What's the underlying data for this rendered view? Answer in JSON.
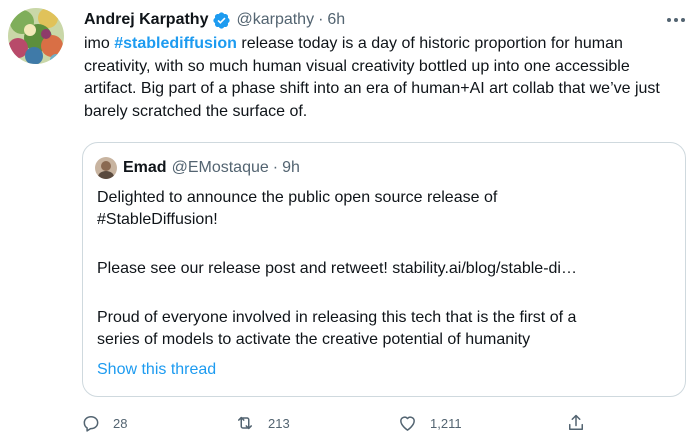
{
  "tweet": {
    "author_name": "Andrej Karpathy",
    "handle": "@karpathy",
    "separator": "·",
    "time": "6h",
    "text_prefix": "imo ",
    "hashtag": "#stablediffusion",
    "text_rest": " release today is a day of historic proportion for human creativity, with so much human visual creativity bottled up into one accessible artifact. Big part of a phase shift into an era of human+AI art collab that we’ve just barely scratched the surface of."
  },
  "quote": {
    "author_name": "Emad",
    "handle": "@EMostaque",
    "separator": "·",
    "time": "9h",
    "line1": "Delighted to announce the public open source release of",
    "line2": "#StableDiffusion!",
    "line3": "Please see our release post and retweet! stability.ai/blog/stable-di…",
    "line4": "Proud of everyone involved in releasing this tech that is the first of a",
    "line5": "series of models to activate the creative potential of humanity",
    "show_thread": "Show this thread"
  },
  "actions": {
    "reply_count": "28",
    "retweet_count": "213",
    "like_count": "1,211"
  },
  "colors": {
    "accent": "#1d9bf0",
    "secondary_text": "#536471",
    "border": "#cfd9de"
  },
  "icons": {
    "verified": "verified-badge-icon",
    "more": "more-icon",
    "reply": "reply-icon",
    "retweet": "retweet-icon",
    "like": "heart-icon",
    "share": "share-icon"
  }
}
